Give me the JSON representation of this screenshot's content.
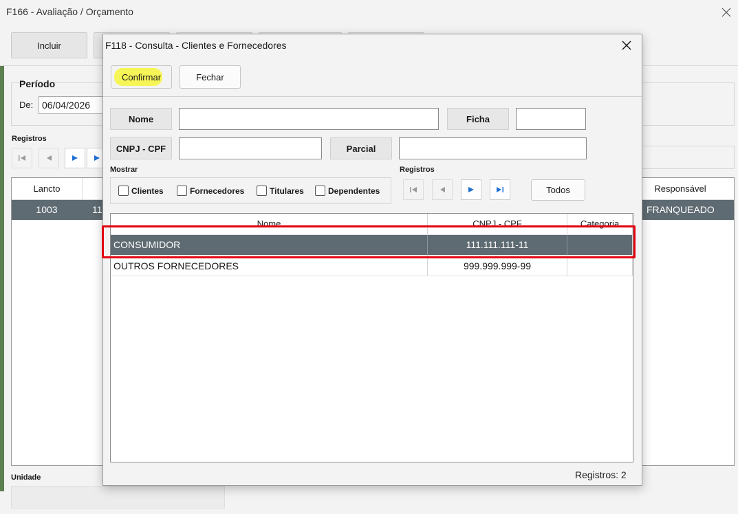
{
  "background_window": {
    "title": "F166 - Avaliação / Orçamento",
    "toolbar": {
      "incluir_label": "Incluir"
    },
    "periodo": {
      "label": "Período",
      "de_label": "De:",
      "de_value": "06/04/2026"
    },
    "registros_label": "Registros",
    "grid": {
      "columns": {
        "lancto": "Lancto",
        "responsavel": "Responsável"
      },
      "rows": [
        {
          "lancto": "1003",
          "partial": "11",
          "responsavel": "FRANQUEADO"
        }
      ]
    },
    "unidade_label": "Unidade"
  },
  "modal": {
    "title": "F118 - Consulta - Clientes e Fornecedores",
    "toolbar": {
      "confirmar_label": "Confirmar",
      "fechar_label": "Fechar"
    },
    "filters": {
      "nome_label": "Nome",
      "nome_value": "",
      "ficha_label": "Ficha",
      "ficha_value": "",
      "cnpj_label": "CNPJ - CPF",
      "cnpj_value": "",
      "parcial_label": "Parcial",
      "parcial_value": ""
    },
    "mostrar": {
      "label": "Mostrar",
      "options": [
        {
          "label": "Clientes",
          "checked": false
        },
        {
          "label": "Fornecedores",
          "checked": false
        },
        {
          "label": "Titulares",
          "checked": false
        },
        {
          "label": "Dependentes",
          "checked": false
        }
      ]
    },
    "registros": {
      "label": "Registros",
      "todos_label": "Todos"
    },
    "grid": {
      "columns": [
        "Nome",
        "CNPJ - CPF",
        "Categoria"
      ],
      "rows": [
        {
          "nome": "CONSUMIDOR",
          "cnpj": "111.111.111-11",
          "categoria": "",
          "selected": true
        },
        {
          "nome": "OUTROS FORNECEDORES",
          "cnpj": "999.999.999-99",
          "categoria": "",
          "selected": false
        }
      ]
    },
    "record_count": "Registros: 2"
  },
  "colors": {
    "selection_row": "#5f6b72",
    "highlight_annotation": "#e3000f",
    "confirm_marker": "#f6f53c",
    "nav_blue": "#1f6fd1"
  },
  "icons": [
    "close-icon",
    "first-record-icon",
    "prev-record-icon",
    "next-record-icon",
    "last-record-icon"
  ]
}
